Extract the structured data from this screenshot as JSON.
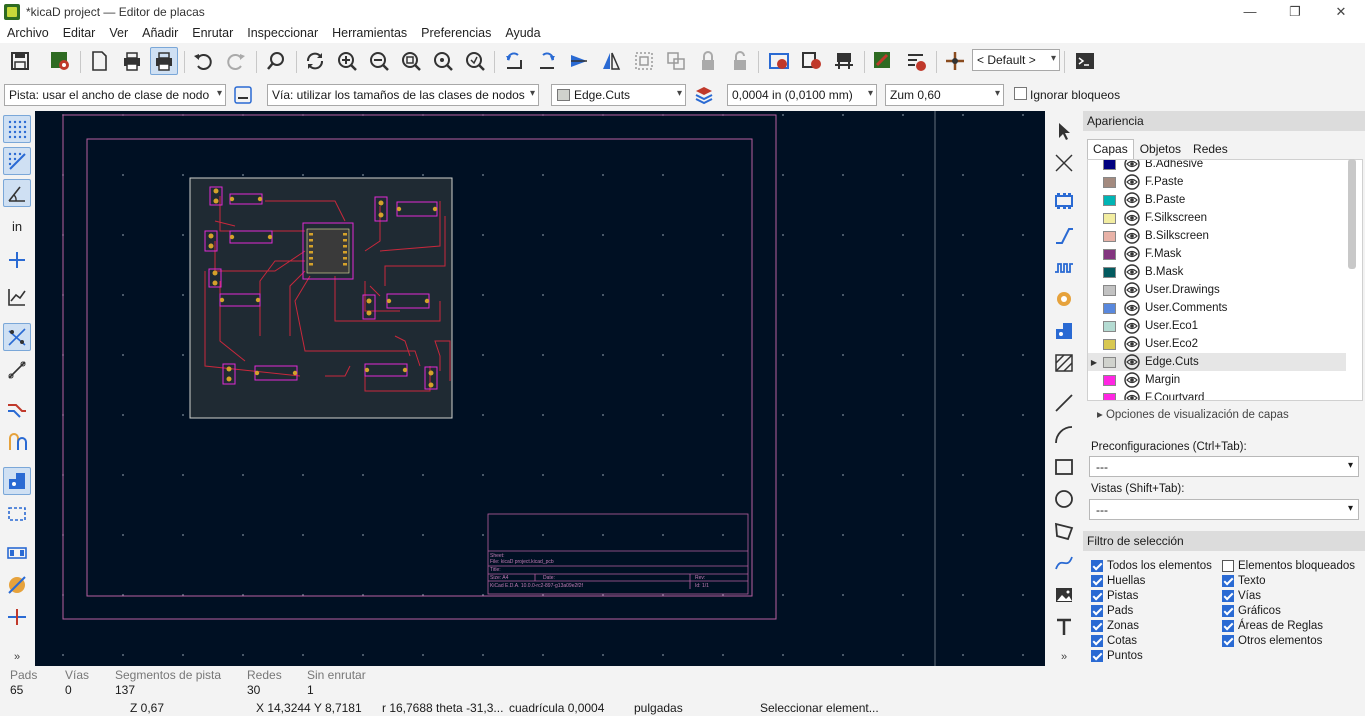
{
  "window": {
    "title": "*kicaD project — Editor de placas"
  },
  "menu": [
    "Archivo",
    "Editar",
    "Ver",
    "Añadir",
    "Enrutar",
    "Inspeccionar",
    "Herramientas",
    "Preferencias",
    "Ayuda"
  ],
  "toolbar": {
    "layer_preset": "< Default >"
  },
  "options_bar": {
    "track_width": "Pista: usar el ancho de clase de nodo",
    "via_size": "Vía: utilizar los tamaños de las clases de nodos",
    "active_layer": "Edge.Cuts",
    "grid": "0,0004 in (0,0100 mm)",
    "zoom": "Zum 0,60",
    "ignore_locks": "Ignorar bloqueos"
  },
  "appearance": {
    "title": "Apariencia",
    "tabs": [
      "Capas",
      "Objetos",
      "Redes"
    ],
    "layers": [
      {
        "name": "B.Adhesive",
        "color": "#00007f"
      },
      {
        "name": "F.Paste",
        "color": "#a38a7f"
      },
      {
        "name": "B.Paste",
        "color": "#00b4b4"
      },
      {
        "name": "F.Silkscreen",
        "color": "#f2eda1"
      },
      {
        "name": "B.Silkscreen",
        "color": "#e8b2a7"
      },
      {
        "name": "F.Mask",
        "color": "#83357f"
      },
      {
        "name": "B.Mask",
        "color": "#025a5f"
      },
      {
        "name": "User.Drawings",
        "color": "#c2c2c2"
      },
      {
        "name": "User.Comments",
        "color": "#5988dd"
      },
      {
        "name": "User.Eco1",
        "color": "#b4dbd2"
      },
      {
        "name": "User.Eco2",
        "color": "#d8c852"
      },
      {
        "name": "Edge.Cuts",
        "color": "#d0d2cd"
      },
      {
        "name": "Margin",
        "color": "#ff26e2"
      },
      {
        "name": "F.Courtyard",
        "color": "#ff26e2"
      }
    ],
    "selected_layer": "Edge.Cuts",
    "layer_display_options": "Opciones de visualización de capas",
    "presets_label": "Preconfiguraciones (Ctrl+Tab):",
    "presets_value": "---",
    "views_label": "Vistas (Shift+Tab):",
    "views_value": "---"
  },
  "selection_filter": {
    "title": "Filtro de selección",
    "left": [
      {
        "label": "Todos los elementos",
        "checked": true
      },
      {
        "label": "Huellas",
        "checked": true
      },
      {
        "label": "Pistas",
        "checked": true
      },
      {
        "label": "Pads",
        "checked": true
      },
      {
        "label": "Zonas",
        "checked": true
      },
      {
        "label": "Cotas",
        "checked": true
      },
      {
        "label": "Puntos",
        "checked": true
      }
    ],
    "right": [
      {
        "label": "Elementos bloqueados",
        "checked": false
      },
      {
        "label": "Texto",
        "checked": true
      },
      {
        "label": "Vías",
        "checked": true
      },
      {
        "label": "Gráficos",
        "checked": true
      },
      {
        "label": "Áreas de Reglas",
        "checked": true
      },
      {
        "label": "Otros elementos",
        "checked": true
      }
    ]
  },
  "messages": [
    {
      "label": "Pads",
      "value": "65"
    },
    {
      "label": "Vías",
      "value": "0"
    },
    {
      "label": "Segmentos de pista",
      "value": "137"
    },
    {
      "label": "Redes",
      "value": "30"
    },
    {
      "label": "Sin enrutar",
      "value": "1"
    }
  ],
  "status": {
    "zoom": "Z 0,67",
    "xy": "X 14,3244  Y 8,7181",
    "polar": "r 16,7688  theta -31,3...",
    "grid": "cuadrícula 0,0004",
    "units": "pulgadas",
    "message": "Seleccionar element..."
  },
  "title_block": {
    "sheet": "Sheet:",
    "file": "File: kicaD project.kicad_pcb",
    "title": "Title:",
    "size": "Size: A4",
    "date": "Date:",
    "rev": "Rev:",
    "kicad": "KiCad E.D.A. 10.0.0-rc2-897-g13a09e2f2f",
    "id": "Id: 1/1"
  }
}
